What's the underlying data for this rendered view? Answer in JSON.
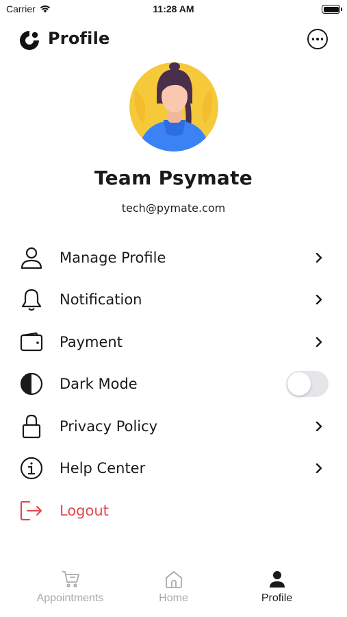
{
  "status_bar": {
    "carrier": "Carrier",
    "time": "11:28 AM"
  },
  "header": {
    "title": "Profile",
    "logo_icon": "psymate-logo-icon",
    "more_icon": "more-options-icon"
  },
  "profile": {
    "name": "Team Psymate",
    "email": "tech@pymate.com"
  },
  "menu": {
    "items": [
      {
        "label": "Manage Profile",
        "icon": "user-icon"
      },
      {
        "label": "Notification",
        "icon": "bell-icon"
      },
      {
        "label": "Payment",
        "icon": "wallet-icon"
      },
      {
        "label": "Dark Mode",
        "icon": "contrast-icon",
        "toggle_on": false
      },
      {
        "label": "Privacy Policy",
        "icon": "lock-icon"
      },
      {
        "label": "Help Center",
        "icon": "info-icon"
      },
      {
        "label": "Logout",
        "icon": "logout-icon"
      }
    ]
  },
  "tabbar": {
    "tabs": [
      {
        "label": "Appointments",
        "icon": "cart-icon",
        "active": false
      },
      {
        "label": "Home",
        "icon": "home-icon",
        "active": false
      },
      {
        "label": "Profile",
        "icon": "person-icon",
        "active": true
      }
    ]
  },
  "colors": {
    "text": "#1a1a1a",
    "logout": "#e5484d",
    "inactive_tab": "#a9a9a9",
    "avatar_bg": "#f6c93a",
    "toggle_off": "#e6e6ea"
  }
}
